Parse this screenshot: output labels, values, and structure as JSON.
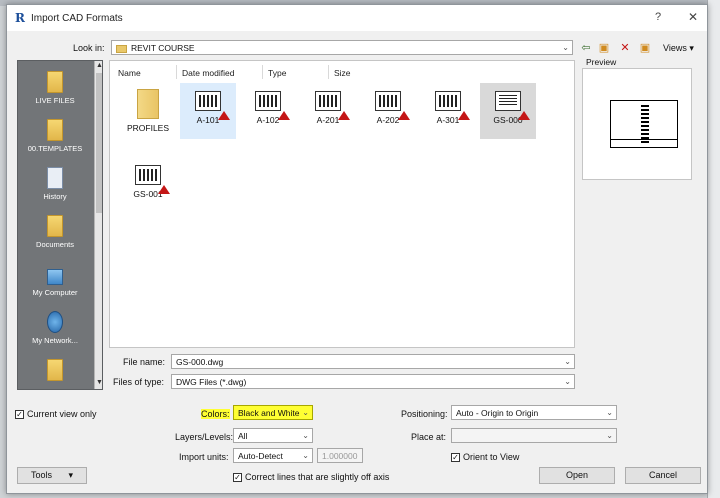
{
  "window": {
    "title": "Import CAD Formats",
    "help": "?",
    "close": "✕"
  },
  "lookin": {
    "label": "Look in:",
    "value": "REVIT COURSE",
    "views_label": "Views"
  },
  "places": [
    {
      "label": "LIVE FILES"
    },
    {
      "label": "00.TEMPLATES"
    },
    {
      "label": "History"
    },
    {
      "label": "Documents"
    },
    {
      "label": "My Computer"
    },
    {
      "label": "My Network..."
    }
  ],
  "columns": [
    "Name",
    "Date modified",
    "Type",
    "Size"
  ],
  "files": [
    {
      "name": "PROFILES",
      "kind": "folder"
    },
    {
      "name": "A-101",
      "kind": "dwg"
    },
    {
      "name": "A-102",
      "kind": "dwg"
    },
    {
      "name": "A-201",
      "kind": "dwg"
    },
    {
      "name": "A-202",
      "kind": "dwg"
    },
    {
      "name": "A-301",
      "kind": "dwg"
    },
    {
      "name": "GS-000",
      "kind": "dwg"
    },
    {
      "name": "GS-001",
      "kind": "dwg"
    }
  ],
  "preview": {
    "label": "Preview"
  },
  "filename": {
    "label": "File name:",
    "value": "GS-000.dwg"
  },
  "filetype": {
    "label": "Files of type:",
    "value": "DWG Files  (*.dwg)"
  },
  "options": {
    "current_view": "Current view only",
    "colors_label": "Colors:",
    "colors_value": "Black and White",
    "layers_label": "Layers/Levels:",
    "layers_value": "All",
    "units_label": "Import units:",
    "units_value": "Auto-Detect",
    "units_scale": "1.000000",
    "correct_lines": "Correct lines that are slightly off axis",
    "positioning_label": "Positioning:",
    "positioning_value": "Auto - Origin to Origin",
    "placeat_label": "Place at:",
    "placeat_value": "",
    "orient": "Orient to View"
  },
  "buttons": {
    "tools": "Tools",
    "open": "Open",
    "cancel": "Cancel"
  },
  "colors": {
    "highlight": "#ffff33",
    "places_bg": "#727578",
    "warn": "#c41616"
  }
}
